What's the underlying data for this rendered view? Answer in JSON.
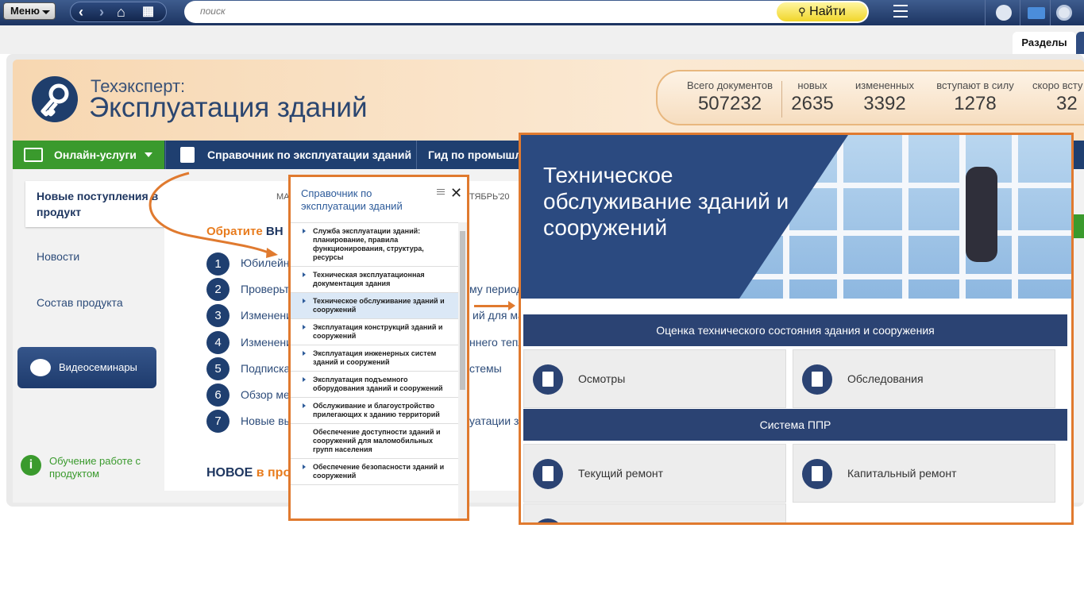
{
  "topbar": {
    "menu_label": "Меню",
    "search_placeholder": "поиск",
    "find_label": "Найти"
  },
  "tabs": {
    "razdely": "Разделы"
  },
  "header": {
    "brand_line1": "Техэксперт:",
    "brand_line2": "Эксплуатация зданий",
    "stats": [
      {
        "label": "Всего документов",
        "value": "507232"
      },
      {
        "label": "новых",
        "value": "2635"
      },
      {
        "label": "измененных",
        "value": "3392"
      },
      {
        "label": "вступают в силу",
        "value": "1278"
      },
      {
        "label": "скоро всту",
        "value": "32"
      }
    ]
  },
  "navbar": {
    "online": "Онлайн-услуги",
    "item1": "Справочник по эксплуатации зданий",
    "item2": "Гид по промышл"
  },
  "sidebar": {
    "new_in_product": "Новые поступления в продукт",
    "news": "Новости",
    "composition": "Состав продукта",
    "video": "Видеосеминары",
    "learn": "Обучение работе с продуктом"
  },
  "main": {
    "top_left": "МА",
    "top_right": "ТЯБРЬ'20",
    "attention_a": "Обратите",
    "attention_b": "ВН",
    "items": [
      {
        "n": "1",
        "text": "Юбилейн",
        "tail": ""
      },
      {
        "n": "2",
        "text": "Проверьт",
        "tail": "му период"
      },
      {
        "n": "3",
        "text": "Изменени",
        "tail": "ий для ма"
      },
      {
        "n": "4",
        "text": "Изменени",
        "tail": "ннего тепл"
      },
      {
        "n": "5",
        "text": "Подписка",
        "tail": "стемы"
      },
      {
        "n": "6",
        "text": "Обзор ме",
        "tail": ""
      },
      {
        "n": "7",
        "text": "Новые вы",
        "tail": "уатации з"
      }
    ],
    "novoe_a": "НОВОЕ",
    "novoe_b": "в про"
  },
  "popup": {
    "title": "Справочник по эксплуатации зданий",
    "items": [
      "Служба эксплуатации зданий: планирование, правила функционирования, структура, ресурсы",
      "Техническая эксплуатационная документация здания",
      "Техническое обслуживание зданий и сооружений",
      "Эксплуатация конструкций зданий и сооружений",
      "Эксплуатация инженерных систем зданий и сооружений",
      "Эксплуатация подъемного оборудования зданий и сооружений",
      "Обслуживание и благоустройство прилегающих к зданию территорий",
      "Обеспечение доступности зданий и сооружений для маломобильных групп населения",
      "Обеспечение безопасности зданий и сооружений"
    ]
  },
  "bigpanel": {
    "hero_title": "Техническое обслуживание зданий и сооружений",
    "section1": "Оценка технического состояния здания и сооружения",
    "card1": "Осмотры",
    "card2": "Обследования",
    "section2": "Система ППР",
    "card3": "Текущий ремонт",
    "card4": "Капитальный ремонт"
  },
  "colors": {
    "accent_orange": "#e07a2f",
    "navy": "#1f3f70",
    "green": "#3a9a2d"
  }
}
